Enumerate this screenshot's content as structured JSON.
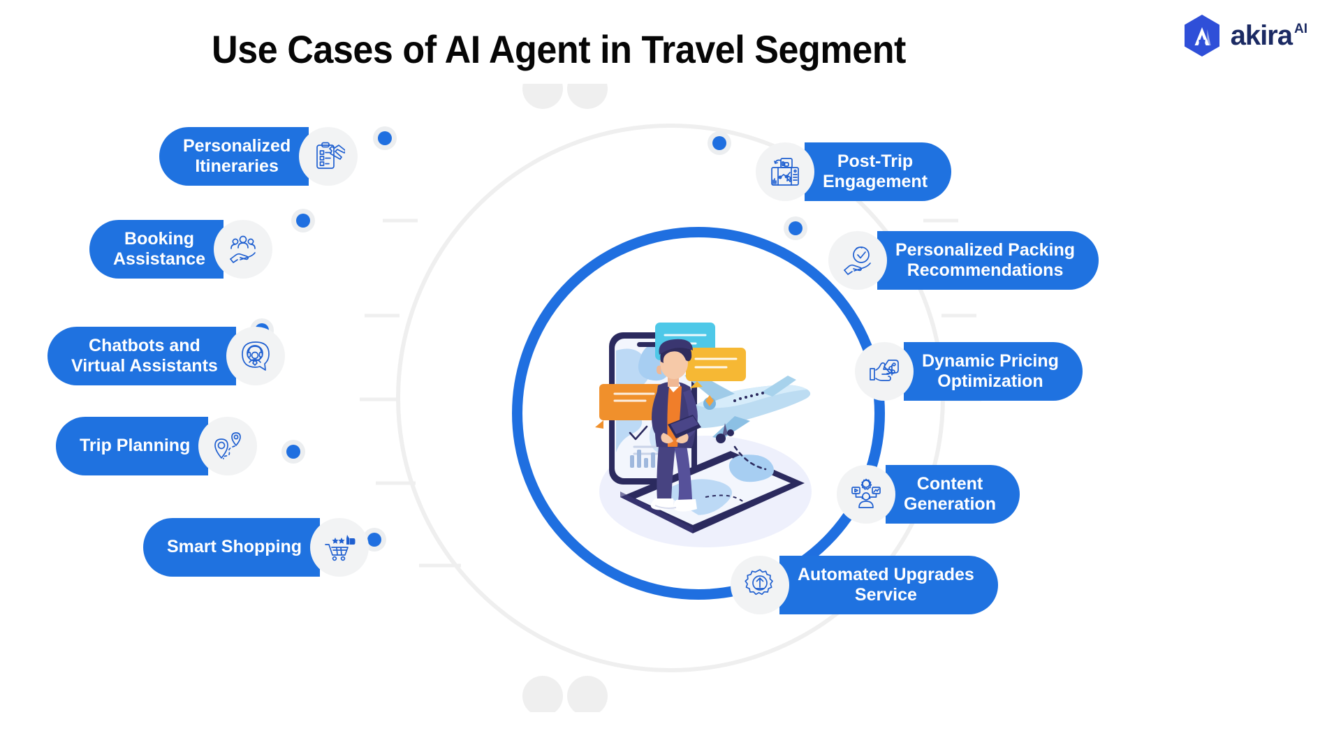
{
  "header": {
    "title": "Use Cases of AI Agent in Travel Segment",
    "logo_text": "akira",
    "logo_sup": "AI"
  },
  "colors": {
    "pill_blue": "#1f72e0",
    "ring_blue": "#1f6fe0",
    "icon_circle": "#f2f3f4",
    "track_gray": "#efefef",
    "title_black": "#060606",
    "logo_navy": "#1b2a63"
  },
  "center": {
    "illustration_name": "traveler-with-smartphone-and-airplane-illustration",
    "alt": "Isometric traveler holding tablet standing on smartphone with chat bubbles and airplane"
  },
  "left_items": [
    {
      "label_lines": [
        "Personalized",
        "Itineraries"
      ],
      "icon": "clipboard-plane-icon"
    },
    {
      "label_lines": [
        "Booking",
        "Assistance"
      ],
      "icon": "people-in-hand-icon"
    },
    {
      "label_lines": [
        "Chatbots and",
        "Virtual Assistants"
      ],
      "icon": "headset-support-chat-icon"
    },
    {
      "label_lines": [
        "Trip Planning"
      ],
      "icon": "map-pins-route-icon"
    },
    {
      "label_lines": [
        "Smart Shopping"
      ],
      "icon": "cart-stars-thumbsup-icon"
    }
  ],
  "right_items": [
    {
      "label_lines": [
        "Post-Trip",
        "Engagement"
      ],
      "icon": "feedback-dashboard-thumbsup-icon"
    },
    {
      "label_lines": [
        "Personalized Packing",
        "Recommendations"
      ],
      "icon": "hand-check-circle-icon"
    },
    {
      "label_lines": [
        "Dynamic Pricing",
        "Optimization"
      ],
      "icon": "price-tag-dollar-thumbsup-icon"
    },
    {
      "label_lines": [
        "Content",
        "Generation"
      ],
      "icon": "content-creator-gear-icon"
    },
    {
      "label_lines": [
        "Automated Upgrades",
        "Service"
      ],
      "icon": "gear-up-arrow-icon"
    }
  ]
}
